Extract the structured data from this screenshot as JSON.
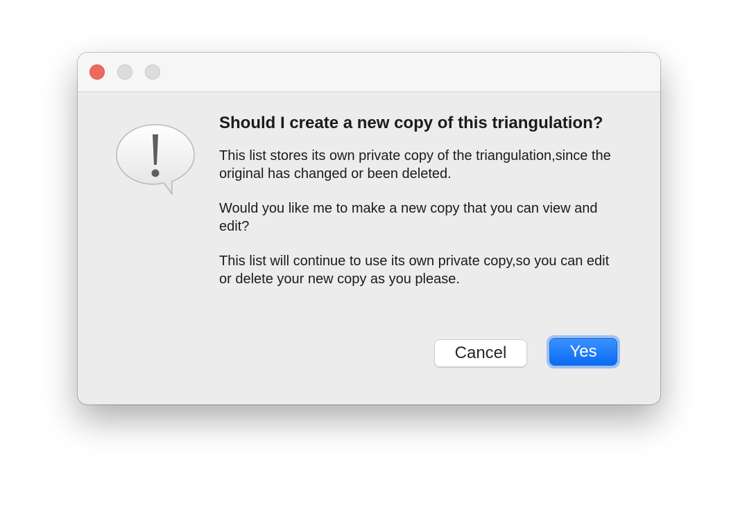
{
  "window": {
    "controls": {
      "close": "close-control",
      "minimize": "minimize-control",
      "zoom": "zoom-control"
    }
  },
  "alert": {
    "icon": "caution-speech-bubble-icon",
    "title": "Should I create a new copy of this triangulation?",
    "paragraphs": [
      "This list stores its own private copy of the triangulation,since the original has changed or been deleted.",
      "Would you like me to make a new copy that you can view and edit?",
      "This list will continue to use its own private copy,so you can edit or delete your new copy as you please."
    ]
  },
  "buttons": {
    "cancel_label": "Cancel",
    "yes_label": "Yes"
  },
  "colors": {
    "accent": "#0a6cf3",
    "close": "#ec6a5e",
    "window_bg": "#ececec"
  }
}
